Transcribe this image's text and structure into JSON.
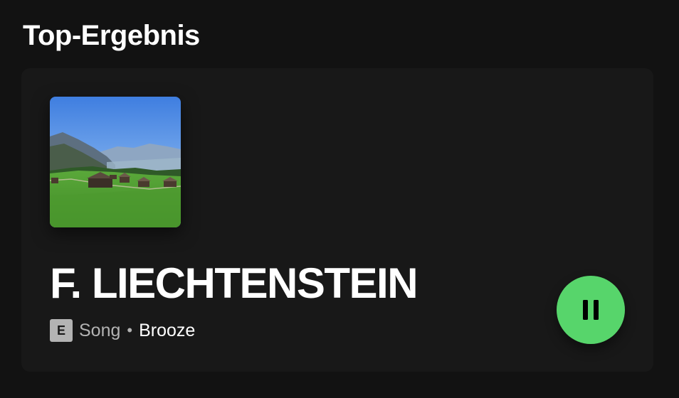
{
  "section": {
    "title": "Top-Ergebnis"
  },
  "top_result": {
    "cover_icon": "landscape-cover-art",
    "title": "F. LIECHTENSTEIN",
    "explicit_badge": "E",
    "type": "Song",
    "separator": "•",
    "artist": "Brooze",
    "play_state_icon": "pause-icon"
  },
  "colors": {
    "background": "#121212",
    "card": "#181818",
    "accent": "#57d56b",
    "text_primary": "#ffffff",
    "text_secondary": "#b3b3b3"
  }
}
